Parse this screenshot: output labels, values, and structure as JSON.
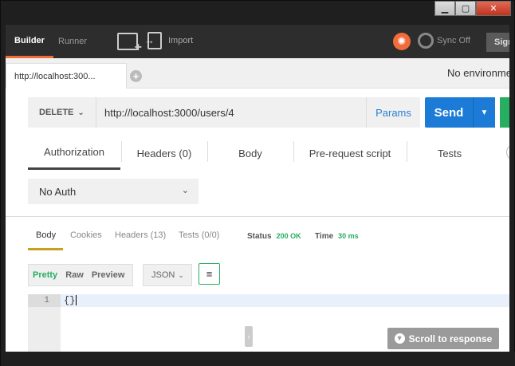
{
  "window": {
    "minimize_label": "▁",
    "maximize_label": "▢",
    "close_label": "✕"
  },
  "header": {
    "tabs": [
      {
        "label": "Builder"
      },
      {
        "label": "Runner"
      }
    ],
    "import_label": "Import",
    "sync_label": "Sync Off",
    "signin_label": "Sign In",
    "accent_color": "#f26b3a"
  },
  "tabbar": {
    "request_tab_label": "http://localhost:300...",
    "add_tab_label": "+",
    "environment_label": "No environment"
  },
  "request": {
    "method": "DELETE",
    "url": "http://localhost:3000/users/4",
    "params_label": "Params",
    "send_label": "Send",
    "tabs": [
      {
        "label": "Authorization"
      },
      {
        "label": "Headers (0)"
      },
      {
        "label": "Body"
      },
      {
        "label": "Pre-request script"
      },
      {
        "label": "Tests"
      }
    ],
    "auth_type": "No Auth"
  },
  "response": {
    "tabs": [
      {
        "label": "Body"
      },
      {
        "label": "Cookies"
      },
      {
        "label": "Headers (13)"
      },
      {
        "label": "Tests (0/0)"
      }
    ],
    "status_label": "Status",
    "status_value": "200 OK",
    "time_label": "Time",
    "time_value": "30 ms",
    "view_modes": [
      {
        "label": "Pretty"
      },
      {
        "label": "Raw"
      },
      {
        "label": "Preview"
      }
    ],
    "format": "JSON",
    "editor": {
      "line_number": "1",
      "content": "{}"
    },
    "scroll_label": "Scroll to response"
  }
}
